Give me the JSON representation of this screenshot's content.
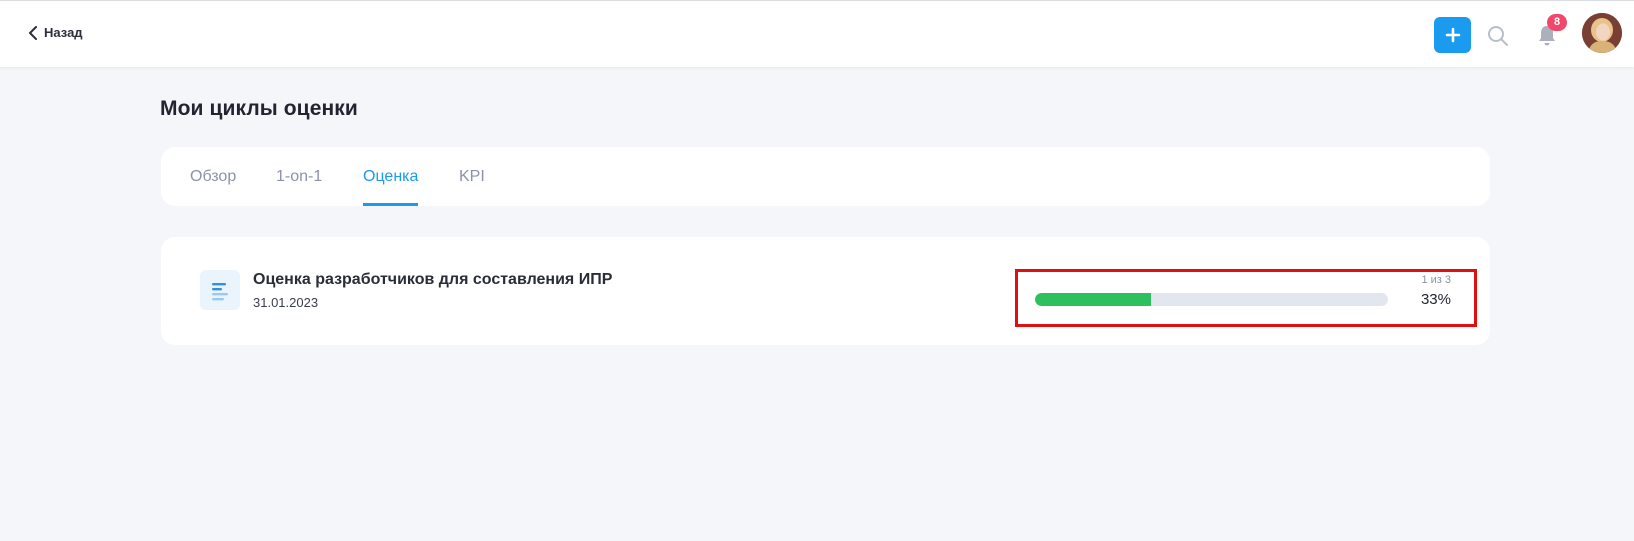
{
  "header": {
    "back_label": "Назад",
    "notifications_count": "8"
  },
  "page": {
    "title": "Мои циклы оценки"
  },
  "tabs": [
    {
      "label": "Обзор",
      "active": false
    },
    {
      "label": "1-on-1",
      "active": false
    },
    {
      "label": "Оценка",
      "active": true
    },
    {
      "label": "KPI",
      "active": false
    }
  ],
  "cycle": {
    "title": "Оценка разработчиков для составления ИПР",
    "date": "31.01.2023",
    "progress": {
      "steps_text": "1 из 3",
      "percent_text": "33%",
      "fraction": 0.33
    }
  },
  "colors": {
    "accent": "#1a9bf0",
    "progress_fill": "#2ec05e",
    "badge": "#f0476b",
    "highlight": "#e01010"
  },
  "icons": {
    "back": "chevron-left-icon",
    "add": "plus-icon",
    "search": "search-icon",
    "notifications": "bell-icon",
    "cycle": "list-lines-icon"
  }
}
